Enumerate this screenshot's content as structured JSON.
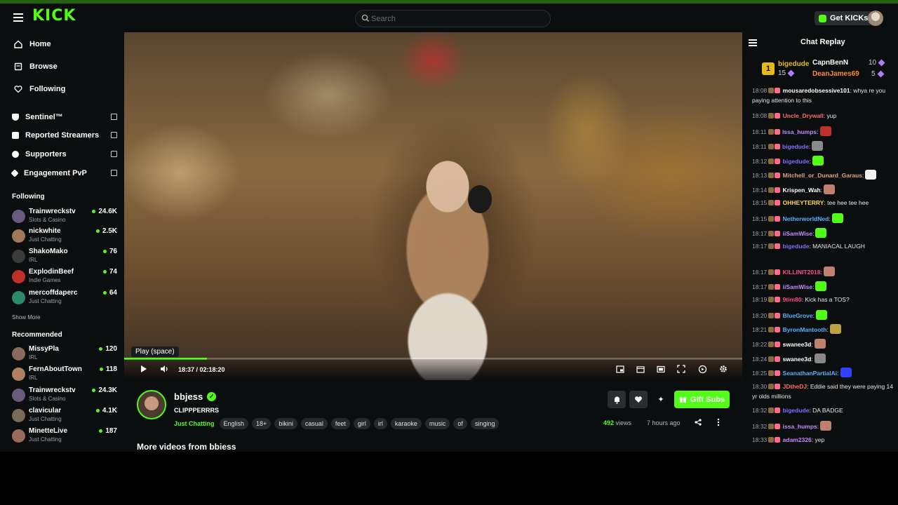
{
  "app": {
    "logo": "KICK"
  },
  "search": {
    "placeholder": "Search"
  },
  "header": {
    "get_kicks": "Get KICKs"
  },
  "sidebar": {
    "nav": [
      {
        "label": "Home",
        "icon": "home-icon"
      },
      {
        "label": "Browse",
        "icon": "browse-icon"
      },
      {
        "label": "Following",
        "icon": "heart-icon"
      }
    ],
    "extra": [
      {
        "label": "Sentinel™"
      },
      {
        "label": "Reported Streamers"
      },
      {
        "label": "Supporters"
      },
      {
        "label": "Engagement PvP"
      }
    ],
    "following_title": "Following",
    "following": [
      {
        "name": "Trainwreckstv",
        "category": "Slots & Casino",
        "viewers": "24.6K",
        "color": "#6a5a7a"
      },
      {
        "name": "nickwhite",
        "category": "Just Chatting",
        "viewers": "2.5K",
        "color": "#a0785a"
      },
      {
        "name": "ShakoMako",
        "category": "IRL",
        "viewers": "76",
        "color": "#3a3a3a"
      },
      {
        "name": "ExplodinBeef",
        "category": "Indie Games",
        "viewers": "74",
        "color": "#c0302a"
      },
      {
        "name": "mercoffdaperc",
        "category": "Just Chatting",
        "viewers": "64",
        "color": "#2a8a6a"
      }
    ],
    "show_more": "Show More",
    "recommended_title": "Recommended",
    "recommended": [
      {
        "name": "MissyPla",
        "category": "IRL",
        "viewers": "120",
        "color": "#8a6a5a"
      },
      {
        "name": "FernAboutTown",
        "category": "IRL",
        "viewers": "118",
        "color": "#b08060"
      },
      {
        "name": "Trainwreckstv",
        "category": "Slots & Casino",
        "viewers": "24.3K",
        "color": "#6a5a7a"
      },
      {
        "name": "clavicular",
        "category": "Just Chatting",
        "viewers": "4.1K",
        "color": "#7a6a5a"
      },
      {
        "name": "MinetteLive",
        "category": "Just Chatting",
        "viewers": "187",
        "color": "#9a6a5a"
      }
    ]
  },
  "player": {
    "tooltip": "Play (space)",
    "time": "18:37 / 02:18:20",
    "progress": 0.134
  },
  "video": {
    "channel": "bbjess",
    "title": "CLIPPPERRRS",
    "category": "Just Chatting",
    "tags": [
      "English",
      "18+",
      "bikini",
      "casual",
      "feet",
      "girl",
      "irl",
      "karaoke",
      "music",
      "of",
      "singing"
    ],
    "gift_label": "Gift Subs",
    "views": "492",
    "views_label": "views",
    "ago": "7 hours ago",
    "more_videos": "More videos from bbiess"
  },
  "chat": {
    "title": "Chat Replay",
    "leaderboard": [
      {
        "name": "bigedude",
        "count": "15"
      },
      {
        "name": "CapnBenN",
        "count": "10"
      },
      {
        "name": "DeanJames69",
        "count": "5"
      }
    ],
    "messages": [
      {
        "time": "18:08",
        "user": "mousaredobsessive101",
        "color": "#ffffff",
        "text": ": whya re you paying attention to this"
      },
      {
        "time": "18:08",
        "user": "Uncle_Drywall",
        "color": "#ff6b6b",
        "text": ": yup"
      },
      {
        "time": "18:11",
        "user": "issa_humps",
        "color": "#c48bff",
        "text": ":"
      },
      {
        "time": "18:11",
        "user": "bigedude",
        "color": "#8b6cff",
        "text": ":"
      },
      {
        "time": "18:12",
        "user": "bigedude",
        "color": "#8b6cff",
        "text": ":"
      },
      {
        "time": "18:13",
        "user": "Mitchell_or_Dunard_Garaus",
        "color": "#e0a080",
        "text": ":"
      },
      {
        "time": "18:14",
        "user": "Krispen_Wah",
        "color": "#ffffff",
        "text": ":"
      },
      {
        "time": "18:15",
        "user": "OHHEYTERRY",
        "color": "#ffd84a",
        "text": ": tee hee tee hee"
      },
      {
        "time": "18:15",
        "user": "NetherworldNed",
        "color": "#5ab0ff",
        "text": ":"
      },
      {
        "time": "18:17",
        "user": "iiSamWise",
        "color": "#c48bff",
        "text": ":"
      },
      {
        "time": "18:17",
        "user": "bigedude",
        "color": "#8b6cff",
        "text": ": MANIACAL LAUGH"
      },
      {
        "time": "18:17",
        "user": "KILLINIT2018",
        "color": "#ff4a8a",
        "text": ":"
      },
      {
        "time": "18:17",
        "user": "iiSamWise",
        "color": "#c48bff",
        "text": ":"
      },
      {
        "time": "18:19",
        "user": "9tim80",
        "color": "#ff4a8a",
        "text": ": Kick has a TOS?"
      },
      {
        "time": "18:20",
        "user": "BlueGrove",
        "color": "#5ab0ff",
        "text": ":"
      },
      {
        "time": "18:21",
        "user": "ByronMantooth",
        "color": "#5ab0ff",
        "text": ":"
      },
      {
        "time": "18:22",
        "user": "swanee3d",
        "color": "#ffffff",
        "text": ":"
      },
      {
        "time": "18:24",
        "user": "swanee3d",
        "color": "#ffffff",
        "text": ":"
      },
      {
        "time": "18:25",
        "user": "SeanathanPartialAi",
        "color": "#5ab0ff",
        "text": ":"
      },
      {
        "time": "18:30",
        "user": "JDtheDJ",
        "color": "#ff6b6b",
        "text": ": Eddie said they were paying 14 yr olds millions"
      },
      {
        "time": "18:32",
        "user": "bigedude",
        "color": "#8b6cff",
        "text": ": DA BADGE"
      },
      {
        "time": "18:32",
        "user": "issa_humps",
        "color": "#c48bff",
        "text": ":"
      },
      {
        "time": "18:33",
        "user": "adam2326",
        "color": "#c48bff",
        "text": ": yep"
      }
    ]
  }
}
